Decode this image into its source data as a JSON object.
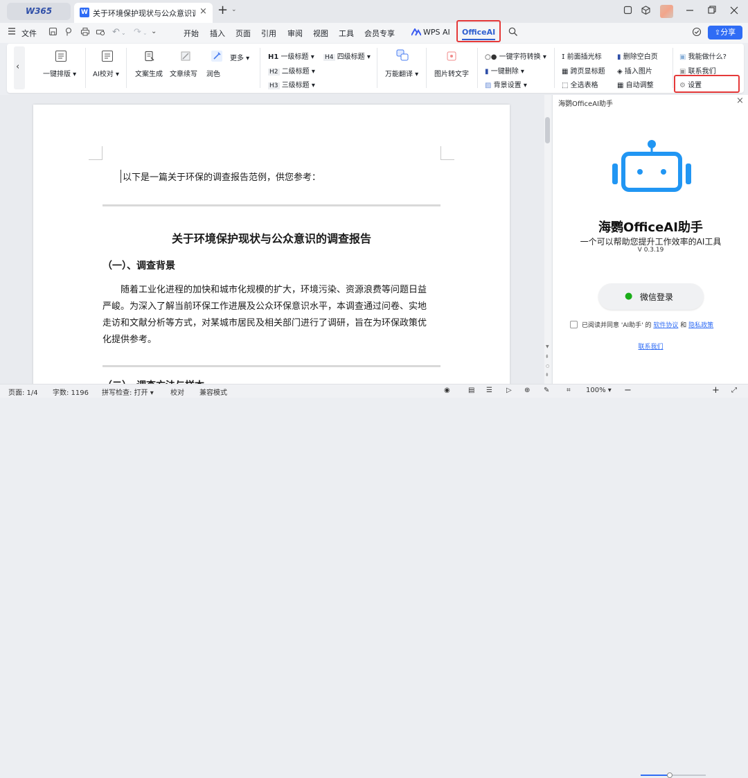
{
  "app": {
    "logo": "W365"
  },
  "tab": {
    "title": "关于环境保护现状与公众意识调查",
    "close": "×"
  },
  "menu": {
    "file": "文件",
    "tabs": [
      "开始",
      "插入",
      "页面",
      "引用",
      "审阅",
      "视图",
      "工具",
      "会员专享"
    ],
    "wps_ai": "WPS AI",
    "officeai": "OfficeAI",
    "share": "分享"
  },
  "ribbon": {
    "one_key_layout": "一键排版",
    "ai_proof": "AI校对",
    "text_gen": "文案生成",
    "continue_write": "文章续写",
    "polish": "润色",
    "more": "更多",
    "h1": "一级标题",
    "h2": "二级标题",
    "h3": "三级标题",
    "h4": "四级标题",
    "translate": "万能翻译",
    "img_to_text": "图片转文字",
    "char_convert": "一键字符转换",
    "one_key_delete": "一键删除",
    "bg_settings": "背景设置",
    "insert_cursor": "前面插光标",
    "cross_page_title": "跨页显标题",
    "select_all_tables": "全选表格",
    "delete_blank_page": "删除空白页",
    "insert_image": "插入图片",
    "auto_adjust": "自动调整",
    "what_can_i_do": "我能做什么?",
    "contact_us": "联系我们",
    "settings": "设置"
  },
  "document": {
    "intro": "以下是一篇关于环保的调查报告范例，供您参考：",
    "title": "关于环境保护现状与公众意识的调查报告",
    "section1": "（一）、调查背景",
    "para1_lines": [
      "随着工业化进程的加快和城市化规模的扩大，环境污染、资源浪费等问题日益",
      "严峻。为深入了解当前环保工作进展及公众环保意识水平，本调查通过问卷、实地",
      "走访和文献分析等方式，对某城市居民及相关部门进行了调研，旨在为环保政策优",
      "化提供参考。"
    ],
    "section2_partial": "（二）、调查方法与样本"
  },
  "panel": {
    "header": "海鹦OfficeAI助手",
    "name": "海鹦OfficeAI助手",
    "tagline": "一个可以帮助您提升工作效率的AI工具",
    "version": "V 0.3.19",
    "wechat_login": "微信登录",
    "agree_prefix": "已阅读并同意 'AI助手' 的",
    "software_agreement": "软件协议",
    "and": "和",
    "privacy_policy": "隐私政策",
    "contact": "联系我们"
  },
  "status": {
    "page": "页面: 1/4",
    "word_count": "字数: 1196",
    "spell_check": "拼写检查: 打开",
    "proofread": "校对",
    "compat_mode": "兼容模式",
    "zoom": "100%",
    "zoom_level": 1.0
  },
  "colors": {
    "accent": "#2f6cf5",
    "highlight_box": "#e53939"
  }
}
